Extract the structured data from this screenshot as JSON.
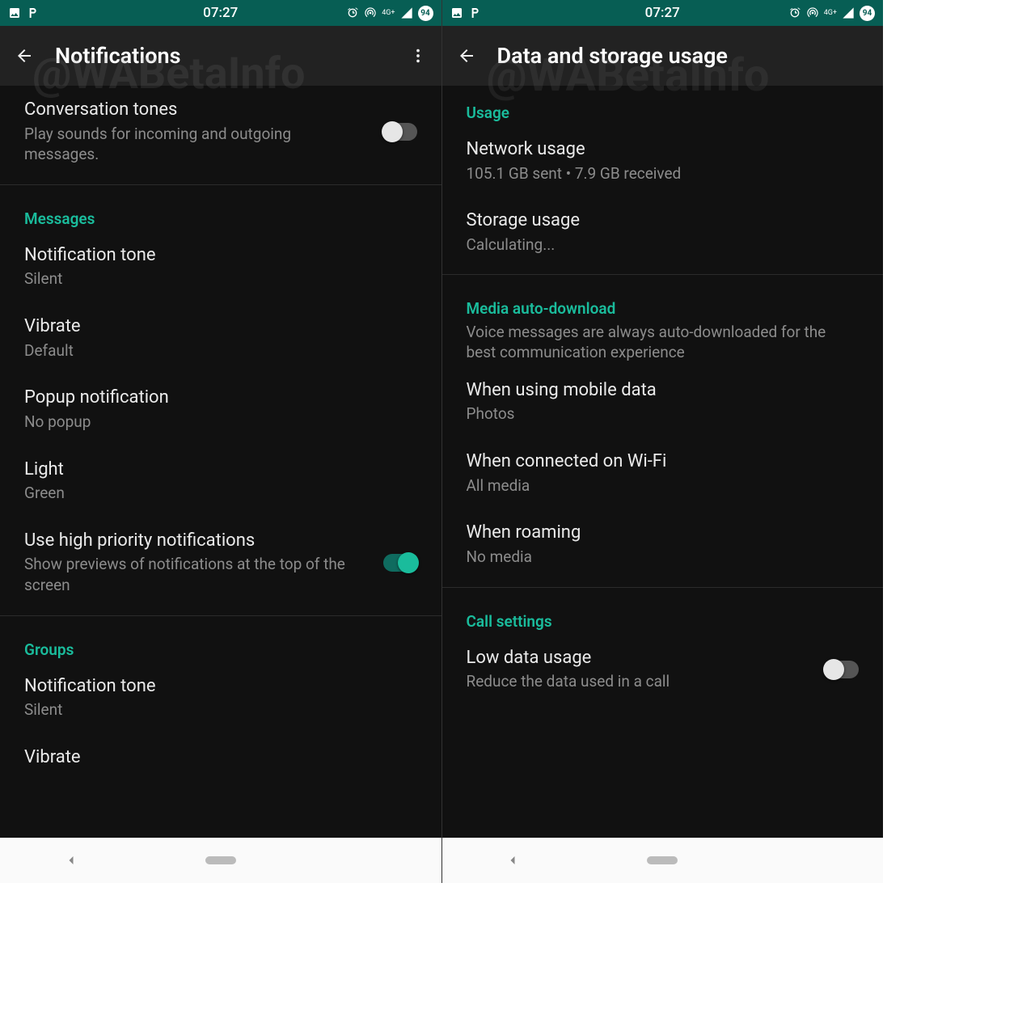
{
  "statusbar": {
    "time": "07:27",
    "badge": "94",
    "net_label": "4G+"
  },
  "left": {
    "title": "Notifications",
    "watermark": "@WABetaInfo",
    "conv_tones_title": "Conversation tones",
    "conv_tones_sub": "Play sounds for incoming and outgoing messages.",
    "messages_header": "Messages",
    "m_notif_tone_title": "Notification tone",
    "m_notif_tone_sub": "Silent",
    "m_vibrate_title": "Vibrate",
    "m_vibrate_sub": "Default",
    "m_popup_title": "Popup notification",
    "m_popup_sub": "No popup",
    "m_light_title": "Light",
    "m_light_sub": "Green",
    "m_highprio_title": "Use high priority notifications",
    "m_highprio_sub": "Show previews of notifications at the top of the screen",
    "groups_header": "Groups",
    "g_notif_tone_title": "Notification tone",
    "g_notif_tone_sub": "Silent",
    "g_vibrate_title": "Vibrate"
  },
  "right": {
    "title": "Data and storage usage",
    "watermark": "@WABetaInfo",
    "usage_header": "Usage",
    "network_title": "Network usage",
    "network_sub": "105.1 GB sent • 7.9 GB received",
    "storage_title": "Storage usage",
    "storage_sub": "Calculating...",
    "media_header": "Media auto-download",
    "media_caption": "Voice messages are always auto-downloaded for the best communication experience",
    "mobile_title": "When using mobile data",
    "mobile_sub": "Photos",
    "wifi_title": "When connected on Wi-Fi",
    "wifi_sub": "All media",
    "roaming_title": "When roaming",
    "roaming_sub": "No media",
    "call_header": "Call settings",
    "low_data_title": "Low data usage",
    "low_data_sub": "Reduce the data used in a call"
  }
}
